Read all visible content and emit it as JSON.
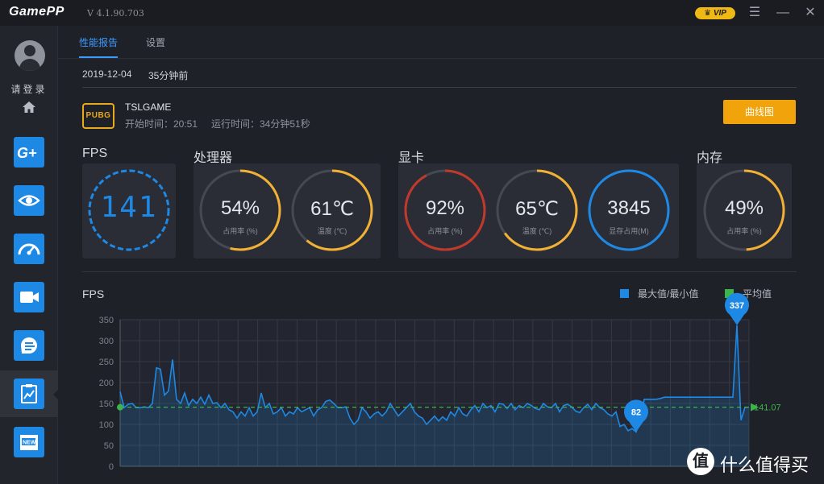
{
  "titlebar": {
    "app_name": "GamePP",
    "version": "V 4.1.90.703",
    "vip": "VIP",
    "menu_glyph": "☰",
    "minimize_glyph": "—",
    "close_glyph": "✕"
  },
  "sidebar": {
    "login": "请登录",
    "items": [
      {
        "name": "g-plus",
        "label": "G+"
      },
      {
        "name": "eye"
      },
      {
        "name": "speedometer"
      },
      {
        "name": "camera"
      },
      {
        "name": "chat"
      },
      {
        "name": "report",
        "active": true
      },
      {
        "name": "news",
        "label": "NEW"
      }
    ]
  },
  "tabs": {
    "report": "性能报告",
    "settings": "设置"
  },
  "session": {
    "date": "2019-12-04",
    "ago": "35分钟前"
  },
  "game": {
    "logo_text": "PUBG",
    "name": "TSLGAME",
    "start": "开始时间：20:51",
    "runtime": "运行时间：34分钟51秒",
    "curve_button": "曲线图"
  },
  "sections": {
    "fps": "FPS",
    "cpu": "处理器",
    "gpu": "显卡",
    "mem": "内存"
  },
  "gauges": {
    "fps": {
      "value": "141"
    },
    "cpu_usage": {
      "value": "54%",
      "label": "占用率 (%)",
      "fraction": 0.54,
      "color": "#f2b134"
    },
    "cpu_temp": {
      "value": "61℃",
      "label": "温度 (℃)",
      "fraction": 0.61,
      "color": "#f2b134"
    },
    "gpu_usage": {
      "value": "92%",
      "label": "占用率 (%)",
      "fraction": 0.92,
      "color": "#c0392b"
    },
    "gpu_temp": {
      "value": "65℃",
      "label": "温度 (℃)",
      "fraction": 0.65,
      "color": "#f2b134"
    },
    "gpu_vram": {
      "value": "3845",
      "label": "显存占用(M)",
      "fraction": 1.0,
      "color": "#1e88e5"
    },
    "mem_usage": {
      "value": "49%",
      "label": "占用率 (%)",
      "fraction": 0.49,
      "color": "#f2b134"
    }
  },
  "chart_title": "FPS",
  "legend": {
    "maxmin": "最大值/最小值",
    "avg": "平均值"
  },
  "chart_data": {
    "type": "area",
    "title": "FPS",
    "ylim": [
      0,
      350
    ],
    "yticks": [
      "0",
      "50",
      "100",
      "150",
      "200",
      "250",
      "300",
      "350"
    ],
    "grid": true,
    "legend_position": "top-right",
    "series": [
      {
        "name": "最大值/最小值",
        "color": "#1e88e5",
        "values": [
          178,
          140,
          148,
          150,
          140,
          140,
          142,
          140,
          150,
          235,
          232,
          170,
          180,
          255,
          160,
          150,
          175,
          145,
          160,
          150,
          165,
          148,
          170,
          150,
          152,
          140,
          150,
          135,
          130,
          115,
          130,
          120,
          140,
          120,
          130,
          175,
          140,
          150,
          125,
          130,
          140,
          120,
          130,
          125,
          140,
          130,
          135,
          140,
          120,
          135,
          140,
          155,
          158,
          150,
          140,
          140,
          142,
          115,
          100,
          110,
          140,
          130,
          115,
          125,
          130,
          120,
          130,
          150,
          135,
          120,
          130,
          140,
          150,
          130,
          120,
          115,
          100,
          110,
          120,
          108,
          118,
          110,
          130,
          120,
          140,
          125,
          120,
          135,
          145,
          130,
          150,
          140,
          145,
          130,
          150,
          148,
          138,
          150,
          135,
          145,
          140,
          150,
          145,
          138,
          135,
          150,
          142,
          140,
          150,
          130,
          145,
          148,
          142,
          132,
          128,
          140,
          148,
          135,
          150,
          140,
          135,
          125,
          120,
          130,
          95,
          100,
          85,
          90,
          82,
          110,
          160,
          160,
          160,
          160,
          162,
          165,
          165,
          165,
          165,
          165,
          165,
          165,
          165,
          165,
          165,
          165,
          165,
          165,
          165,
          165,
          165,
          165,
          165,
          337,
          110,
          141,
          141
        ]
      }
    ],
    "average": 141.07,
    "average_label": "141.07",
    "average_color": "#3cb44b",
    "max": {
      "label": "337"
    },
    "min": {
      "label": "82"
    }
  },
  "watermark": {
    "mark": "值",
    "text": "什么值得买"
  }
}
